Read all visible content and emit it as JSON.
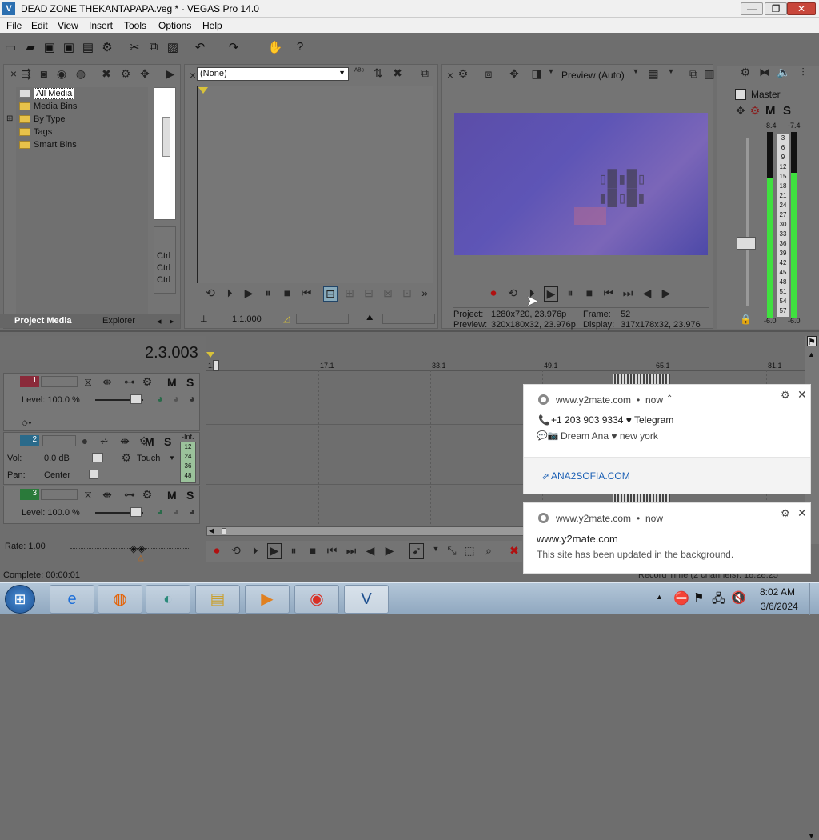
{
  "window": {
    "title": "DEAD ZONE THEKANTAPAPA.veg * - VEGAS Pro 14.0",
    "app_icon": "V"
  },
  "menu": [
    "File",
    "Edit",
    "View",
    "Insert",
    "Tools",
    "Options",
    "Help"
  ],
  "media": {
    "tree": [
      "All Media",
      "Media Bins",
      "By Type",
      "Tags",
      "Smart Bins"
    ],
    "tabs": [
      "Project Media",
      "Explorer"
    ],
    "side_labels": [
      "Ctrl",
      "Ctrl",
      "Ctrl"
    ]
  },
  "trimmer": {
    "dropdown": "(None)",
    "timecode": "1.1.000"
  },
  "preview": {
    "mode": "Preview (Auto)",
    "project_label": "Project:",
    "project_value": "1280x720, 23.976p",
    "preview_label": "Preview:",
    "preview_value": "320x180x32, 23.976p",
    "frame_label": "Frame:",
    "frame_value": "52",
    "display_label": "Display:",
    "display_value": "317x178x32, 23.976"
  },
  "master": {
    "title": "Master",
    "m": "M",
    "s": "S",
    "peak_left": "-8.4",
    "peak_right": "-7.4",
    "scale": [
      "3",
      "6",
      "9",
      "12",
      "15",
      "18",
      "21",
      "24",
      "27",
      "30",
      "33",
      "36",
      "39",
      "42",
      "45",
      "48",
      "51",
      "54",
      "57"
    ],
    "bottom_left": "-6.0",
    "bottom_right": "-6.0",
    "level_left": 0.75,
    "level_right": 0.78
  },
  "timeline": {
    "cursor": "2.3.003",
    "ruler": [
      "1.1",
      "17.1",
      "33.1",
      "49.1",
      "65.1",
      "81.1"
    ],
    "tracks": [
      {
        "num": "1",
        "level": "Level: 100.0 %",
        "m": "M",
        "s": "S"
      },
      {
        "num": "2",
        "vol_label": "Vol:",
        "vol": "0.0 dB",
        "pan_label": "Pan:",
        "pan": "Center",
        "mode": "Touch",
        "m": "M",
        "s": "S",
        "inf": "-Inf.",
        "meter_scale": [
          "12",
          "24",
          "36",
          "48"
        ]
      },
      {
        "num": "3",
        "level": "Level: 100.0 %",
        "m": "M",
        "s": "S"
      }
    ],
    "rate": "Rate: 1.00",
    "status": "Complete: 00:00:01",
    "record_time": "Record Time (2 channels): 18:28:25"
  },
  "notifications": [
    {
      "source": "www.y2mate.com",
      "time": "now",
      "line1": "+1 203 903 9334 ♥ Telegram",
      "line2": "Dream Ana ♥ new york",
      "action": "ANA2SOFIA.COM"
    },
    {
      "source": "www.y2mate.com",
      "time": "now",
      "title": "www.y2mate.com",
      "body": "This site has been updated in the background."
    }
  ],
  "clock": {
    "time": "8:02 AM",
    "date": "3/6/2024"
  },
  "colors": {
    "accent": "#2b6fb0",
    "meter_green": "#3fe03f",
    "track1": "#8a2a3a",
    "track2": "#2a6a8a",
    "track3": "#2a7a3a"
  }
}
